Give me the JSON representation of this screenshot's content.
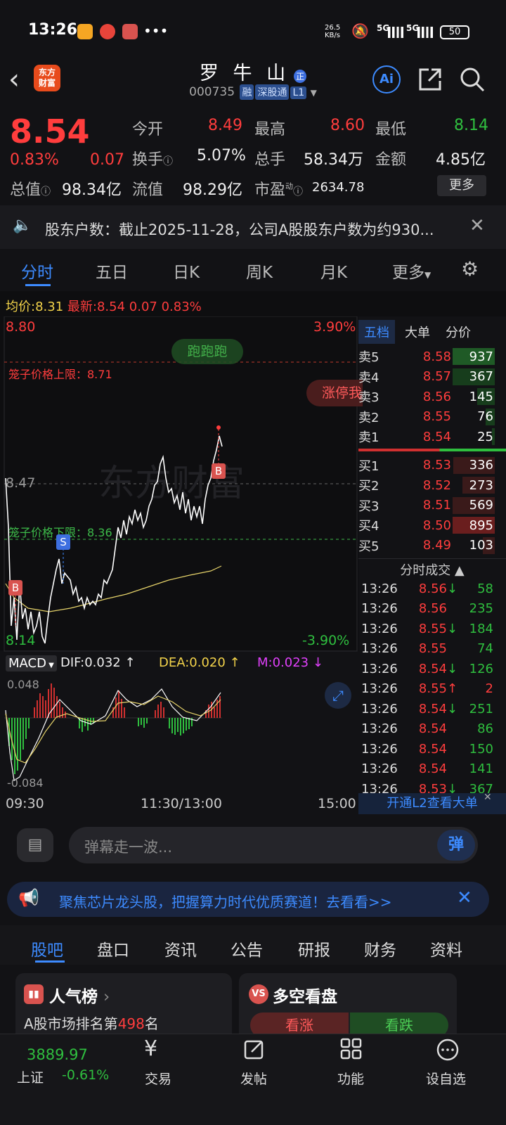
{
  "status": {
    "time": "13:26",
    "net_speed": "26.5\nKB/s",
    "net1": "5G",
    "net2": "5G",
    "battery": "50"
  },
  "header": {
    "logo_text": "东方\n财富",
    "title": "罗 牛 山",
    "code": "000735",
    "tags": [
      "融",
      "深股通",
      "L1"
    ],
    "ai_label": "Ai"
  },
  "quote": {
    "price": "8.54",
    "pct": "0.83%",
    "change": "0.07",
    "open_label": "今开",
    "open": "8.49",
    "high_label": "最高",
    "high": "8.60",
    "low_label": "最低",
    "low": "8.14",
    "turnover_label": "换手",
    "turnover": "5.07%",
    "volume_label": "总手",
    "volume": "58.34万",
    "amount_label": "金额",
    "amount": "4.85亿",
    "mktcap_label": "总值",
    "mktcap": "98.34亿",
    "float_label": "流值",
    "float": "98.29亿",
    "pe_label": "市盈",
    "pe_sup": "动",
    "pe": "2634.78",
    "more": "更多"
  },
  "notice": "股东户数：截止2025-11-28，公司A股股东户数为约930...",
  "tabs": [
    "分时",
    "五日",
    "日K",
    "周K",
    "月K",
    "更多"
  ],
  "chart_info": {
    "avg_label": "均价:",
    "avg": "8.31",
    "last_label": "最新:",
    "last": "8.54",
    "chg": "0.07",
    "pct": "0.83%"
  },
  "chart_labels": {
    "top_price": "8.80",
    "top_pct": "3.90%",
    "mid_price": "8.47",
    "bottom_price": "8.14",
    "bottom_pct": "-3.90%",
    "run_badge": "跑跑跑",
    "upper_limit": "笼子价格上限：8.71",
    "lower_limit": "笼子价格下限：8.36",
    "limit_btn": "涨停我",
    "marker_b": "B",
    "marker_s": "S",
    "watermark": "东方财富"
  },
  "macd": {
    "label": "MACD",
    "dif": "DIF:0.032",
    "dea": "DEA:0.020",
    "m": "M:0.023",
    "top": "0.048",
    "bottom": "-0.084"
  },
  "time_axis": [
    "09:30",
    "11:30/13:00",
    "15:00"
  ],
  "orderbook": {
    "tabs": [
      "五档",
      "大单",
      "分价"
    ],
    "sells": [
      [
        "卖5",
        "8.58",
        "937"
      ],
      [
        "卖4",
        "8.57",
        "367"
      ],
      [
        "卖3",
        "8.56",
        "145"
      ],
      [
        "卖2",
        "8.55",
        "76"
      ],
      [
        "卖1",
        "8.54",
        "25"
      ]
    ],
    "buys": [
      [
        "买1",
        "8.53",
        "336"
      ],
      [
        "买2",
        "8.52",
        "273"
      ],
      [
        "买3",
        "8.51",
        "569"
      ],
      [
        "买4",
        "8.50",
        "895"
      ],
      [
        "买5",
        "8.49",
        "103"
      ]
    ],
    "trades_title": "分时成交",
    "trades": [
      [
        "13:26",
        "8.56",
        "↓",
        "58"
      ],
      [
        "13:26",
        "8.56",
        "",
        "235"
      ],
      [
        "13:26",
        "8.55",
        "↓",
        "184"
      ],
      [
        "13:26",
        "8.55",
        "",
        "74"
      ],
      [
        "13:26",
        "8.54",
        "↓",
        "126"
      ],
      [
        "13:26",
        "8.55",
        "↑",
        "2"
      ],
      [
        "13:26",
        "8.54",
        "↓",
        "251"
      ],
      [
        "13:26",
        "8.54",
        "",
        "86"
      ],
      [
        "13:26",
        "8.54",
        "",
        "150"
      ],
      [
        "13:26",
        "8.54",
        "",
        "141"
      ],
      [
        "13:26",
        "8.53",
        "↓",
        "367"
      ]
    ],
    "l2_link": "开通L2查看大单"
  },
  "comment": {
    "placeholder": "弹幕走一波...",
    "send": "弹"
  },
  "banner": "聚焦芯片龙头股，把握算力时代优质赛道！去看看>>",
  "bottom_tabs": [
    "股吧",
    "盘口",
    "资讯",
    "公告",
    "研报",
    "财务",
    "资料"
  ],
  "cards": {
    "popular": "人气榜",
    "rank_prefix": "A股市场排名第",
    "rank": "498",
    "rank_suffix": "名",
    "bull_bear": "多空看盘",
    "bull": "看涨",
    "bear": "看跌"
  },
  "index": {
    "value": "3889.97",
    "name": "上证",
    "pct": "-0.61%"
  },
  "nav": [
    "交易",
    "发帖",
    "功能",
    "设自选"
  ],
  "colors": {
    "up": "#ff3d3d",
    "down": "#2fbf3f",
    "accent": "#3d8bff",
    "bg": "#121215"
  }
}
